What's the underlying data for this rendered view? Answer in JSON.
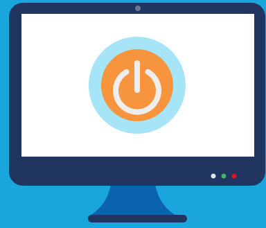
{
  "scene": {
    "background": "#1aa6dc"
  },
  "monitor": {
    "bezel_color": "#213561",
    "screen_color": "#ffffff",
    "stand_color": "#0b63b0",
    "base_color": "#213561",
    "webcam_color": "#6a7797"
  },
  "power_button": {
    "icon": "power-icon",
    "outer_ring_color": "#a6e4f7",
    "inner_circle_color": "#f7943e",
    "symbol_color": "#f0eded"
  },
  "indicator_lights": [
    {
      "name": "indicator-light-white",
      "color": "#dde7ea"
    },
    {
      "name": "indicator-light-green",
      "color": "#45b36b"
    },
    {
      "name": "indicator-light-red",
      "color": "#e0141e"
    }
  ]
}
